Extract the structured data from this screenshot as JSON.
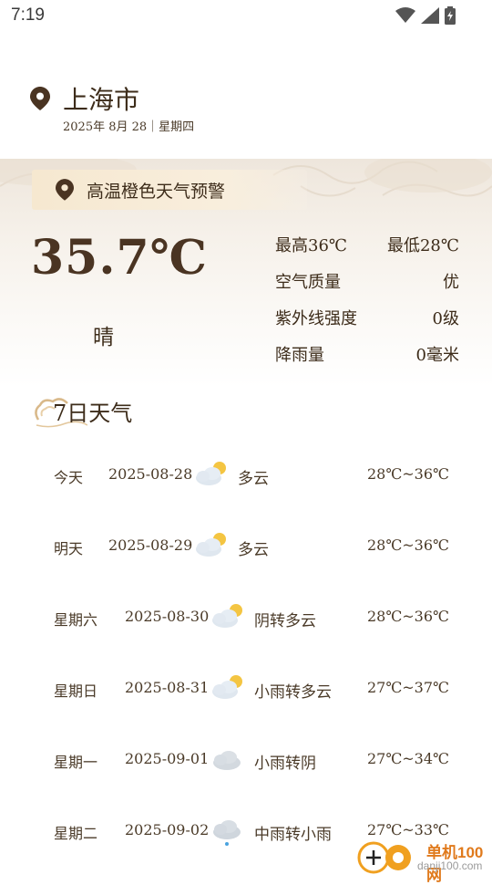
{
  "status": {
    "time": "7:19"
  },
  "location": {
    "city": "上海市",
    "date_line": "2025年 8月 28｜星期四"
  },
  "alert": {
    "text": "高温橙色天气预警"
  },
  "current": {
    "temperature": "35.7℃",
    "condition": "晴",
    "high": "最高36℃",
    "low": "最低28℃",
    "air_quality_label": "空气质量",
    "air_quality_value": "优",
    "uv_label": "紫外线强度",
    "uv_value": "0级",
    "rain_label": "降雨量",
    "rain_value": "0毫米"
  },
  "forecast_title": "7日天气",
  "forecast": [
    {
      "day": "今天",
      "date": "2025-08-28",
      "icon": "partly-cloudy-icon",
      "condition": "多云",
      "temp": "28℃~36℃"
    },
    {
      "day": "明天",
      "date": "2025-08-29",
      "icon": "partly-cloudy-icon",
      "condition": "多云",
      "temp": "28℃~36℃"
    },
    {
      "day": "星期六",
      "date": "2025-08-30",
      "icon": "partly-cloudy-icon",
      "condition": "阴转多云",
      "temp": "28℃~36℃"
    },
    {
      "day": "星期日",
      "date": "2025-08-31",
      "icon": "partly-cloudy-icon",
      "condition": "小雨转多云",
      "temp": "27℃~37℃"
    },
    {
      "day": "星期一",
      "date": "2025-09-01",
      "icon": "cloudy-icon",
      "condition": "小雨转阴",
      "temp": "27℃~34℃"
    },
    {
      "day": "星期二",
      "date": "2025-09-02",
      "icon": "rain-icon",
      "condition": "中雨转小雨",
      "temp": "27℃~33℃"
    }
  ],
  "watermark": {
    "name": "单机100网",
    "url": "danji100.com"
  },
  "colors": {
    "accent": "#4a3422",
    "alert_bg": "#f6e8d0",
    "sun": "#f4c542",
    "cloud": "#d6dde6"
  }
}
